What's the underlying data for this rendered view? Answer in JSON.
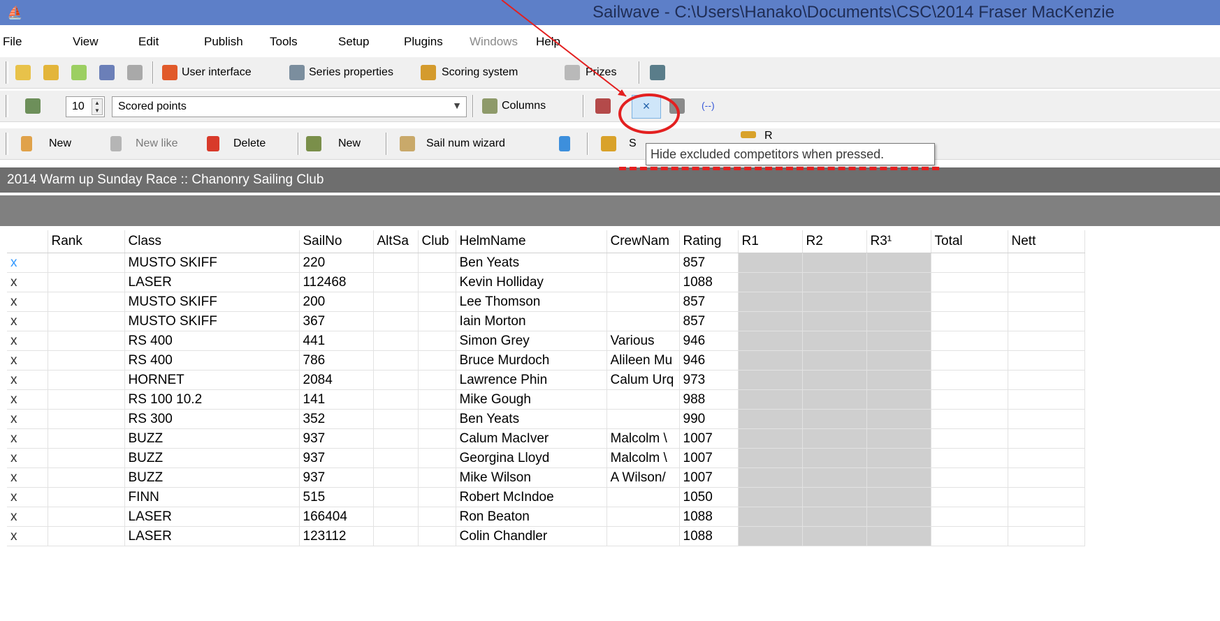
{
  "window": {
    "title": "Sailwave - C:\\Users\\Hanako\\Documents\\CSC\\2014 Fraser MacKenzie"
  },
  "menu": [
    "File",
    "View",
    "Edit",
    "Publish",
    "Tools",
    "Setup",
    "Plugins",
    "Windows",
    "Help"
  ],
  "toolbar1": {
    "user_interface": "User interface",
    "series_properties": "Series properties",
    "scoring_system": "Scoring system",
    "prizes": "Prizes"
  },
  "toolbar2": {
    "spin_value": "10",
    "combo_value": "Scored points",
    "columns": "Columns",
    "hide_excluded": "×",
    "brackets": "(--)"
  },
  "toolbar3": {
    "new": "New",
    "new_like": "New like",
    "delete": "Delete",
    "new2": "New",
    "sail_num_wizard": "Sail num wizard",
    "s_partial": "S",
    "r_partial": "R"
  },
  "tooltip": "Hide excluded competitors when pressed.",
  "series_title": "2014 Warm up Sunday Race :: Chanonry Sailing Club",
  "table": {
    "headers": [
      "",
      "Rank",
      "Class",
      "SailNo",
      "AltSa",
      "Club",
      "HelmName",
      "CrewNam",
      "Rating",
      "R1",
      "R2",
      "R3¹",
      "Total",
      "Nett"
    ],
    "rows": [
      [
        "x",
        "",
        "MUSTO SKIFF",
        "220",
        "",
        "",
        "Ben Yeats",
        "",
        "857"
      ],
      [
        "x",
        "",
        "LASER",
        "112468",
        "",
        "",
        "Kevin Holliday",
        "",
        "1088"
      ],
      [
        "x",
        "",
        "MUSTO SKIFF",
        "200",
        "",
        "",
        "Lee Thomson",
        "",
        "857"
      ],
      [
        "x",
        "",
        "MUSTO SKIFF",
        "367",
        "",
        "",
        "Iain Morton",
        "",
        "857"
      ],
      [
        "x",
        "",
        "RS 400",
        "441",
        "",
        "",
        "Simon Grey",
        "Various",
        "946"
      ],
      [
        "x",
        "",
        "RS 400",
        "786",
        "",
        "",
        "Bruce Murdoch",
        "Alileen Mu",
        "946"
      ],
      [
        "x",
        "",
        "HORNET",
        "2084",
        "",
        "",
        "Lawrence Phin",
        "Calum Urq",
        "973"
      ],
      [
        "x",
        "",
        "RS 100 10.2",
        "141",
        "",
        "",
        "Mike Gough",
        "",
        "988"
      ],
      [
        "x",
        "",
        "RS 300",
        "352",
        "",
        "",
        "Ben Yeats",
        "",
        "990"
      ],
      [
        "x",
        "",
        "BUZZ",
        "937",
        "",
        "",
        "Calum MacIver",
        "Malcolm \\",
        "1007"
      ],
      [
        "x",
        "",
        "BUZZ",
        "937",
        "",
        "",
        "Georgina Lloyd",
        "Malcolm \\",
        "1007"
      ],
      [
        "x",
        "",
        "BUZZ",
        "937",
        "",
        "",
        "Mike Wilson",
        "A Wilson/",
        "1007"
      ],
      [
        "x",
        "",
        "FINN",
        "515",
        "",
        "",
        "Robert McIndoe",
        "",
        "1050"
      ],
      [
        "x",
        "",
        "LASER",
        "166404",
        "",
        "",
        "Ron Beaton",
        "",
        "1088"
      ],
      [
        "x",
        "",
        "LASER",
        "123112",
        "",
        "",
        "Colin Chandler",
        "",
        "1088"
      ]
    ]
  },
  "colors": {
    "accent_red": "#e32020",
    "title_bar": "#5d7fc8",
    "band": "#6e6e6e"
  }
}
